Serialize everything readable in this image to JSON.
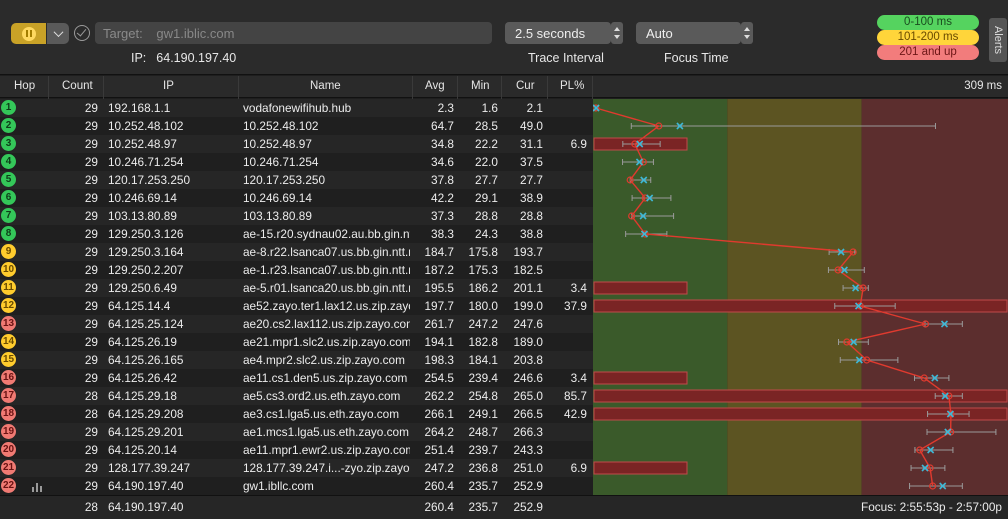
{
  "toolbar": {
    "target_label": "Target:",
    "target_value": "gw1.iblic.com",
    "ip_label": "IP:",
    "ip_value": "64.190.197.40",
    "trace_interval_value": "2.5 seconds",
    "trace_interval_label": "Trace Interval",
    "focus_time_value": "Auto",
    "focus_time_label": "Focus Time",
    "legend": {
      "green": "0-100 ms",
      "yellow": "101-200 ms",
      "red": "201 and up"
    },
    "alerts_label": "Alerts"
  },
  "table": {
    "headers": {
      "hop": "Hop",
      "count": "Count",
      "ip": "IP",
      "name": "Name",
      "avg": "Avg",
      "min": "Min",
      "cur": "Cur",
      "pl": "PL%",
      "scale": "309 ms"
    },
    "rows": [
      {
        "hop": "1",
        "status": "green",
        "count": "29",
        "ip": "192.168.1.1",
        "name": "vodafonewifihub.hub",
        "avg": "2.3",
        "min": "1.6",
        "cur": "2.1",
        "pl": ""
      },
      {
        "hop": "2",
        "status": "green",
        "count": "29",
        "ip": "10.252.48.102",
        "name": "10.252.48.102",
        "avg": "64.7",
        "min": "28.5",
        "cur": "49.0",
        "pl": ""
      },
      {
        "hop": "3",
        "status": "green",
        "count": "29",
        "ip": "10.252.48.97",
        "name": "10.252.48.97",
        "avg": "34.8",
        "min": "22.2",
        "cur": "31.1",
        "pl": "6.9"
      },
      {
        "hop": "4",
        "status": "green",
        "count": "29",
        "ip": "10.246.71.254",
        "name": "10.246.71.254",
        "avg": "34.6",
        "min": "22.0",
        "cur": "37.5",
        "pl": ""
      },
      {
        "hop": "5",
        "status": "green",
        "count": "29",
        "ip": "120.17.253.250",
        "name": "120.17.253.250",
        "avg": "37.8",
        "min": "27.7",
        "cur": "27.7",
        "pl": ""
      },
      {
        "hop": "6",
        "status": "green",
        "count": "29",
        "ip": "10.246.69.14",
        "name": "10.246.69.14",
        "avg": "42.2",
        "min": "29.1",
        "cur": "38.9",
        "pl": ""
      },
      {
        "hop": "7",
        "status": "green",
        "count": "29",
        "ip": "103.13.80.89",
        "name": "103.13.80.89",
        "avg": "37.3",
        "min": "28.8",
        "cur": "28.8",
        "pl": ""
      },
      {
        "hop": "8",
        "status": "green",
        "count": "29",
        "ip": "129.250.3.126",
        "name": "ae-15.r20.sydnau02.au.bb.gin.ntt.net",
        "avg": "38.3",
        "min": "24.3",
        "cur": "38.8",
        "pl": ""
      },
      {
        "hop": "9",
        "status": "yellow",
        "count": "29",
        "ip": "129.250.3.164",
        "name": "ae-8.r22.lsanca07.us.bb.gin.ntt.net",
        "avg": "184.7",
        "min": "175.8",
        "cur": "193.7",
        "pl": ""
      },
      {
        "hop": "10",
        "status": "yellow",
        "count": "29",
        "ip": "129.250.2.207",
        "name": "ae-1.r23.lsanca07.us.bb.gin.ntt.net",
        "avg": "187.2",
        "min": "175.3",
        "cur": "182.5",
        "pl": ""
      },
      {
        "hop": "11",
        "status": "yellow",
        "count": "29",
        "ip": "129.250.6.49",
        "name": "ae-5.r01.lsanca20.us.bb.gin.ntt.net",
        "avg": "195.5",
        "min": "186.2",
        "cur": "201.1",
        "pl": "3.4"
      },
      {
        "hop": "12",
        "status": "yellow",
        "count": "29",
        "ip": "64.125.14.4",
        "name": "ae52.zayo.ter1.lax12.us.zip.zayo.com",
        "avg": "197.7",
        "min": "180.0",
        "cur": "199.0",
        "pl": "37.9"
      },
      {
        "hop": "13",
        "status": "red",
        "count": "29",
        "ip": "64.125.25.124",
        "name": "ae20.cs2.lax112.us.zip.zayo.com",
        "avg": "261.7",
        "min": "247.2",
        "cur": "247.6",
        "pl": ""
      },
      {
        "hop": "14",
        "status": "yellow",
        "count": "29",
        "ip": "64.125.26.19",
        "name": "ae21.mpr1.slc2.us.zip.zayo.com",
        "avg": "194.1",
        "min": "182.8",
        "cur": "189.0",
        "pl": ""
      },
      {
        "hop": "15",
        "status": "yellow",
        "count": "29",
        "ip": "64.125.26.165",
        "name": "ae4.mpr2.slc2.us.zip.zayo.com",
        "avg": "198.3",
        "min": "184.1",
        "cur": "203.8",
        "pl": ""
      },
      {
        "hop": "16",
        "status": "red",
        "count": "29",
        "ip": "64.125.26.42",
        "name": "ae11.cs1.den5.us.zip.zayo.com",
        "avg": "254.5",
        "min": "239.4",
        "cur": "246.6",
        "pl": "3.4"
      },
      {
        "hop": "17",
        "status": "red",
        "count": "28",
        "ip": "64.125.29.18",
        "name": "ae5.cs3.ord2.us.eth.zayo.com",
        "avg": "262.2",
        "min": "254.8",
        "cur": "265.0",
        "pl": "85.7"
      },
      {
        "hop": "18",
        "status": "red",
        "count": "28",
        "ip": "64.125.29.208",
        "name": "ae3.cs1.lga5.us.eth.zayo.com",
        "avg": "266.1",
        "min": "249.1",
        "cur": "266.5",
        "pl": "42.9"
      },
      {
        "hop": "19",
        "status": "red",
        "count": "29",
        "ip": "64.125.29.201",
        "name": "ae1.mcs1.lga5.us.eth.zayo.com",
        "avg": "264.2",
        "min": "248.7",
        "cur": "266.3",
        "pl": ""
      },
      {
        "hop": "20",
        "status": "red",
        "count": "29",
        "ip": "64.125.20.14",
        "name": "ae11.mpr1.ewr2.us.zip.zayo.com",
        "avg": "251.4",
        "min": "239.7",
        "cur": "243.3",
        "pl": ""
      },
      {
        "hop": "21",
        "status": "red",
        "count": "29",
        "ip": "128.177.39.247",
        "name": "128.177.39.247.i...-zyo.zip.zayo.com",
        "avg": "247.2",
        "min": "236.8",
        "cur": "251.0",
        "pl": "6.9"
      },
      {
        "hop": "22",
        "status": "red",
        "count": "29",
        "ip": "64.190.197.40",
        "name": "gw1.ibllc.com",
        "avg": "260.4",
        "min": "235.7",
        "cur": "252.9",
        "pl": ""
      }
    ],
    "footer": {
      "count": "28",
      "ip": "64.190.197.40",
      "avg": "260.4",
      "min": "235.7",
      "cur": "252.9",
      "focus": "Focus: 2:55:53p - 2:57:00p"
    }
  },
  "graph": {
    "max_ms": 309,
    "zones": [
      {
        "upto": 100,
        "color": "#3a5a2a"
      },
      {
        "upto": 200,
        "color": "#5c5422"
      },
      {
        "upto": 309,
        "color": "#5c2e2e"
      }
    ],
    "points": [
      {
        "avg": 2.3,
        "cur": 2.1,
        "min": 1.6,
        "max": 3
      },
      {
        "avg": 64.7,
        "cur": 49.0,
        "min": 28.5,
        "max": 255
      },
      {
        "avg": 34.8,
        "cur": 31.1,
        "min": 22.2,
        "max": 50
      },
      {
        "avg": 34.6,
        "cur": 37.5,
        "min": 22.0,
        "max": 45
      },
      {
        "avg": 37.8,
        "cur": 27.7,
        "min": 27.7,
        "max": 43
      },
      {
        "avg": 42.2,
        "cur": 38.9,
        "min": 29.1,
        "max": 58
      },
      {
        "avg": 37.3,
        "cur": 28.8,
        "min": 28.8,
        "max": 60
      },
      {
        "avg": 38.3,
        "cur": 38.8,
        "min": 24.3,
        "max": 55
      },
      {
        "avg": 184.7,
        "cur": 193.7,
        "min": 175.8,
        "max": 195
      },
      {
        "avg": 187.2,
        "cur": 182.5,
        "min": 175.3,
        "max": 202
      },
      {
        "avg": 195.5,
        "cur": 201.1,
        "min": 186.2,
        "max": 205
      },
      {
        "avg": 197.7,
        "cur": 199.0,
        "min": 180.0,
        "max": 225
      },
      {
        "avg": 261.7,
        "cur": 247.6,
        "min": 247.2,
        "max": 275
      },
      {
        "avg": 194.1,
        "cur": 189.0,
        "min": 182.8,
        "max": 205
      },
      {
        "avg": 198.3,
        "cur": 203.8,
        "min": 184.1,
        "max": 227
      },
      {
        "avg": 254.5,
        "cur": 246.6,
        "min": 239.4,
        "max": 265
      },
      {
        "avg": 262.2,
        "cur": 265.0,
        "min": 254.8,
        "max": 275
      },
      {
        "avg": 266.1,
        "cur": 266.5,
        "min": 249.1,
        "max": 280
      },
      {
        "avg": 264.2,
        "cur": 266.3,
        "min": 248.7,
        "max": 300
      },
      {
        "avg": 251.4,
        "cur": 243.3,
        "min": 239.7,
        "max": 268
      },
      {
        "avg": 247.2,
        "cur": 251.0,
        "min": 236.8,
        "max": 262
      },
      {
        "avg": 260.4,
        "cur": 252.9,
        "min": 235.7,
        "max": 275
      }
    ]
  },
  "colors": {
    "accent": "#c9a227",
    "loss_bar": "#7a2424",
    "line": "#e03a2e",
    "marker": "#3fb8d6"
  }
}
